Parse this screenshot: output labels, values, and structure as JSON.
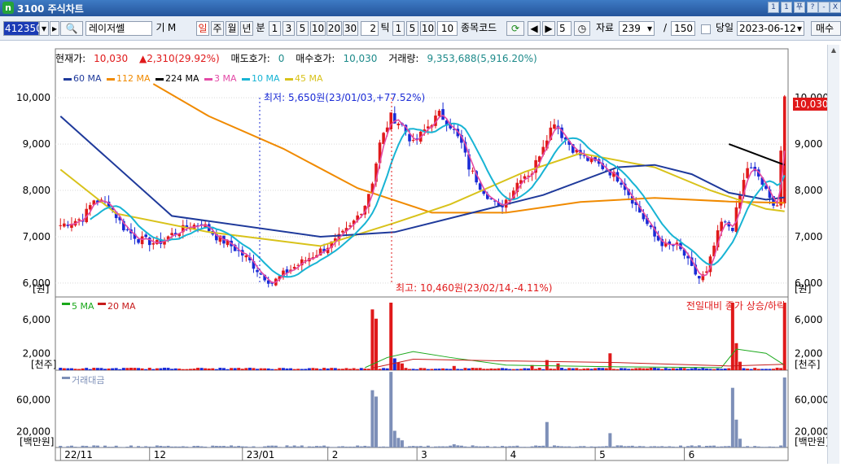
{
  "window": {
    "logo": "n",
    "title": "3100 주식차트",
    "controls": [
      "1",
      "1",
      "푸",
      "?",
      "-",
      "X"
    ]
  },
  "toolbar": {
    "code": "412350",
    "name": "레이저쎌",
    "gi": "기",
    "m": "M",
    "period_tabs": [
      "일",
      "주",
      "월",
      "년",
      "분"
    ],
    "minute_values": [
      "1",
      "3",
      "5",
      "10",
      "20",
      "30"
    ],
    "tick_input": "2",
    "tick_label": "틱",
    "tick_values": [
      "1",
      "5",
      "10",
      "10"
    ],
    "code_link": "종목코드",
    "step": "5",
    "data_label": "자료",
    "data_count": "239",
    "slash": "/",
    "max_count": "150",
    "today_label": "당일",
    "date": "2023-06-12",
    "trade_button": "매수"
  },
  "info": {
    "current_label": "현재가:",
    "current_value": "10,030",
    "change_value": "2,310(29.92%)",
    "ask_label": "매도호가:",
    "ask_value": "0",
    "bid_label": "매수호가:",
    "bid_value": "10,030",
    "volume_label": "거래량:",
    "volume_value": "9,353,688(5,916.20%)"
  },
  "colors": {
    "up": "#e0191a",
    "down": "#1a2bd6",
    "ma60": "#1f3a9b",
    "ma112": "#f08a00",
    "ma224": "#000000",
    "ma3": "#e34aa6",
    "ma10": "#18b4d4",
    "ma45": "#d8c21a",
    "vol_ma5": "#1aa81a",
    "vol_ma20": "#c61b1b",
    "amount_bar": "#7d8fb8"
  },
  "chart_data": {
    "type": "candlestick",
    "price_panel": {
      "y_range": [
        5700,
        10600
      ],
      "y_ticks": [
        "10,000",
        "9,000",
        "8,000",
        "7,000",
        "6,000"
      ],
      "y_unit": "[원]",
      "right_tag": "10,030",
      "legend": [
        "60 MA",
        "112 MA",
        "224 MA",
        "3 MA",
        "10 MA",
        "45 MA"
      ],
      "annotations": {
        "min_text": "최저: 5,650원(23/01/03,+77.52%)",
        "max_text": "최고: 10,460원(23/02/14,-4.11%)"
      },
      "anchors": [
        [
          0,
          7250
        ],
        [
          6,
          7400
        ],
        [
          9,
          7800
        ],
        [
          13,
          7700
        ],
        [
          17,
          7200
        ],
        [
          21,
          6950
        ],
        [
          26,
          6850
        ],
        [
          30,
          7050
        ],
        [
          34,
          7200
        ],
        [
          38,
          7300
        ],
        [
          42,
          7000
        ],
        [
          46,
          6800
        ],
        [
          50,
          6550
        ],
        [
          54,
          6200
        ],
        [
          57,
          6000
        ],
        [
          61,
          6250
        ],
        [
          66,
          6500
        ],
        [
          70,
          6700
        ],
        [
          74,
          6900
        ],
        [
          78,
          7200
        ],
        [
          82,
          7700
        ],
        [
          84,
          8200
        ],
        [
          86,
          9000
        ],
        [
          89,
          9600
        ],
        [
          92,
          9400
        ],
        [
          95,
          9000
        ],
        [
          98,
          9300
        ],
        [
          102,
          9650
        ],
        [
          105,
          9400
        ],
        [
          108,
          9000
        ],
        [
          110,
          8500
        ],
        [
          113,
          8100
        ],
        [
          116,
          7800
        ],
        [
          118,
          7600
        ],
        [
          121,
          7900
        ],
        [
          124,
          8300
        ],
        [
          127,
          8400
        ],
        [
          130,
          9000
        ],
        [
          133,
          9500
        ],
        [
          135,
          9200
        ],
        [
          138,
          8900
        ],
        [
          141,
          8700
        ],
        [
          144,
          8600
        ],
        [
          148,
          8400
        ],
        [
          151,
          8200
        ],
        [
          154,
          7800
        ],
        [
          157,
          7400
        ],
        [
          160,
          7000
        ],
        [
          163,
          6800
        ],
        [
          166,
          6800
        ],
        [
          168,
          6600
        ],
        [
          170,
          6300
        ],
        [
          172,
          6100
        ],
        [
          174,
          6200
        ],
        [
          176,
          6800
        ],
        [
          178,
          7300
        ],
        [
          181,
          7200
        ],
        [
          183,
          7900
        ],
        [
          185,
          8500
        ],
        [
          188,
          8300
        ],
        [
          191,
          7800
        ],
        [
          193,
          7700
        ],
        [
          195,
          10030
        ]
      ],
      "ma_series": {
        "ma60": [
          [
            0,
            9600
          ],
          [
            30,
            7450
          ],
          [
            70,
            7000
          ],
          [
            90,
            7100
          ],
          [
            110,
            7500
          ],
          [
            130,
            7900
          ],
          [
            150,
            8500
          ],
          [
            160,
            8550
          ],
          [
            170,
            8350
          ],
          [
            180,
            7950
          ],
          [
            190,
            7800
          ],
          [
            195,
            7850
          ]
        ],
        "ma112": [
          [
            25,
            10300
          ],
          [
            40,
            9600
          ],
          [
            60,
            8900
          ],
          [
            80,
            8050
          ],
          [
            100,
            7520
          ],
          [
            120,
            7520
          ],
          [
            140,
            7750
          ],
          [
            160,
            7840
          ],
          [
            180,
            7760
          ],
          [
            195,
            7730
          ]
        ],
        "ma224": [
          [
            180,
            9000
          ],
          [
            185,
            8850
          ],
          [
            190,
            8700
          ],
          [
            195,
            8550
          ]
        ],
        "ma45": [
          [
            0,
            8450
          ],
          [
            15,
            7500
          ],
          [
            40,
            7100
          ],
          [
            70,
            6800
          ],
          [
            90,
            7300
          ],
          [
            105,
            7700
          ],
          [
            125,
            8400
          ],
          [
            140,
            8800
          ],
          [
            160,
            8500
          ],
          [
            175,
            8000
          ],
          [
            190,
            7600
          ],
          [
            195,
            7550
          ]
        ]
      },
      "ma10_lag": 4,
      "ma3_lag": 1
    },
    "volume_panel": {
      "legend": [
        "5 MA",
        "20 MA"
      ],
      "right_legend": "전일대비 종가 상승/하락",
      "y_ticks": [
        "6,000",
        "2,000"
      ],
      "y_unit": "[천주]",
      "y_max": 8000,
      "big_bars": [
        [
          84,
          7200,
          "up"
        ],
        [
          85,
          6100,
          "up"
        ],
        [
          89,
          8000,
          "up"
        ],
        [
          90,
          1400,
          "down"
        ],
        [
          91,
          900,
          "up"
        ],
        [
          92,
          800,
          "up"
        ],
        [
          106,
          500,
          "up"
        ],
        [
          127,
          600,
          "up"
        ],
        [
          131,
          1200,
          "up"
        ],
        [
          134,
          800,
          "up"
        ],
        [
          148,
          2000,
          "up"
        ],
        [
          181,
          8000,
          "up"
        ],
        [
          182,
          3200,
          "up"
        ],
        [
          183,
          1000,
          "up"
        ],
        [
          195,
          8000,
          "up"
        ]
      ]
    },
    "amount_panel": {
      "legend": [
        "거래대금"
      ],
      "y_ticks": [
        "60,000",
        "20,000"
      ],
      "y_unit": "[백만원]",
      "y_max": 90000,
      "big_bars": [
        [
          84,
          72000
        ],
        [
          85,
          64000
        ],
        [
          89,
          95000
        ],
        [
          90,
          21000
        ],
        [
          91,
          12000
        ],
        [
          92,
          9000
        ],
        [
          106,
          4000
        ],
        [
          131,
          32000
        ],
        [
          148,
          18000
        ],
        [
          181,
          75000
        ],
        [
          182,
          35000
        ],
        [
          183,
          11000
        ],
        [
          195,
          88000
        ]
      ]
    },
    "x_labels": [
      "22/11",
      "12",
      "23/01",
      "2",
      "3",
      "4",
      "5",
      "6"
    ],
    "x_label_index": [
      0,
      24,
      49,
      72,
      96,
      120,
      144,
      168
    ],
    "candle_count": 196
  }
}
